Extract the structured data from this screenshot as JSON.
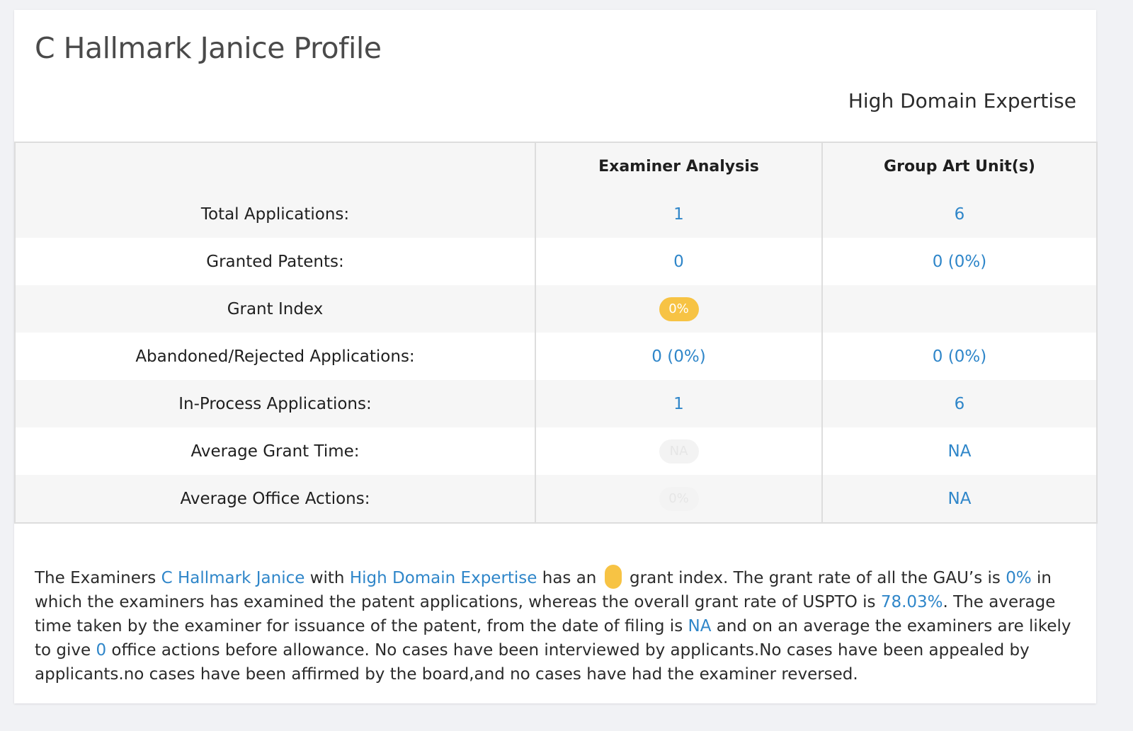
{
  "page": {
    "title": "C Hallmark Janice Profile",
    "expertise": "High Domain Expertise"
  },
  "table": {
    "headers": [
      "",
      "Examiner Analysis",
      "Group Art Unit(s)"
    ],
    "rows": [
      {
        "label": "Total Applications:",
        "examiner": "1",
        "gau": "6"
      },
      {
        "label": "Granted Patents:",
        "examiner": "0",
        "gau": "0 (0%)"
      },
      {
        "label": "Grant Index",
        "examiner": "0%",
        "gau": ""
      },
      {
        "label": "Abandoned/Rejected Applications:",
        "examiner": "0 (0%)",
        "gau": "0 (0%)"
      },
      {
        "label": "In-Process Applications:",
        "examiner": "1",
        "gau": "6"
      },
      {
        "label": "Average Grant Time:",
        "examiner": "NA",
        "gau": "NA"
      },
      {
        "label": "Average Office Actions:",
        "examiner": "0%",
        "gau": "NA"
      }
    ]
  },
  "colors": {
    "accent_link": "#2f86c9",
    "grant_index_badge": "#f7c344"
  },
  "summary": {
    "t1": "The Examiners ",
    "examiner_name": "C Hallmark Janice",
    "t2": " with ",
    "expertise": "High Domain Expertise",
    "t3": " has an ",
    "t4": " grant index. The grant rate of all the GAU’s is ",
    "gau_grant_rate": "0%",
    "t5": " in which the examiners has examined the patent applications, whereas the overall grant rate of USPTO is ",
    "uspto_grant_rate": "78.03%",
    "t6": ". The average time taken by the examiner for issuance of the patent, from the date of filing is ",
    "avg_time": "NA",
    "t7": " and on an average the examiners are likely to give ",
    "office_actions": "0",
    "t8": " office actions before allowance. No cases have been interviewed by applicants.No cases have been appealed by applicants.no cases have been affirmed by the board,and no cases have had the examiner reversed."
  }
}
